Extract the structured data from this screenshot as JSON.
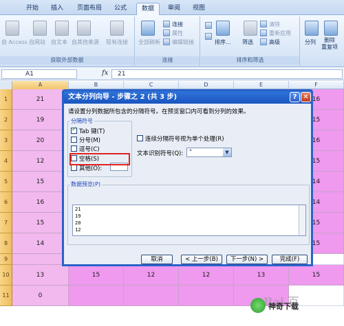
{
  "ribbon": {
    "tabs": [
      "开始",
      "插入",
      "页面布局",
      "公式",
      "数据",
      "审阅",
      "视图"
    ],
    "active_tab": "数据",
    "groups": {
      "external": {
        "label": "获取外部数据",
        "buttons": [
          "自 Access",
          "自网站",
          "自文本",
          "自其他来源",
          "现有连接"
        ]
      },
      "connections": {
        "label": "连接",
        "refresh": "全部刷新",
        "items": [
          "连接",
          "属性",
          "编辑链接"
        ]
      },
      "sort_filter": {
        "label": "排序和筛选",
        "sort": "排序...",
        "filter": "筛选",
        "items": [
          "清除",
          "重新应用",
          "高级"
        ]
      },
      "tools": {
        "split": "分列",
        "dedup": "删除\n重复项"
      }
    }
  },
  "formula_bar": {
    "name_box": "A1",
    "fx": "fx",
    "value": "21"
  },
  "grid": {
    "columns": [
      "A",
      "B",
      "C",
      "D",
      "E",
      "F"
    ],
    "rows": [
      "1",
      "2",
      "3",
      "4",
      "5",
      "6",
      "7",
      "8",
      "9",
      "10",
      "11"
    ],
    "col_a": [
      "21",
      "19",
      "20",
      "12",
      "15",
      "16",
      "15",
      "14",
      "",
      "13",
      "0"
    ],
    "col_f": [
      "16",
      "15",
      "16",
      "15",
      "14",
      "14",
      "15",
      "15",
      "",
      "",
      ""
    ],
    "row10": [
      "15",
      "12",
      "12",
      "13",
      "15"
    ]
  },
  "dialog": {
    "title": "文本分列向导 - 步骤之 2 (共 3 步)",
    "help": "?",
    "close": "✕",
    "description": "请设置分列数据所包含的分隔符号。在预览窗口内可看到分列的效果。",
    "delimiters_legend": "分隔符号",
    "delimiters": [
      {
        "label": "Tab 键(T)",
        "checked": true
      },
      {
        "label": "分号(M)",
        "checked": false
      },
      {
        "label": "逗号(C)",
        "checked": false
      },
      {
        "label": "空格(S)",
        "checked": false
      },
      {
        "label": "其他(O):",
        "checked": false
      }
    ],
    "consecutive": "连续分隔符号视为单个处理(R)",
    "qualifier_label": "文本识别符号(Q):",
    "qualifier_value": "\"",
    "preview_legend": "数据预览(P)",
    "preview_lines": [
      "21",
      "19",
      "20",
      "12"
    ],
    "buttons": {
      "cancel": "取消",
      "back": "< 上一步(B)",
      "next": "下一步(N) >",
      "finish": "完成(F)"
    }
  },
  "watermark": {
    "site": "神奇下载",
    "baidu": "Bai 百"
  }
}
